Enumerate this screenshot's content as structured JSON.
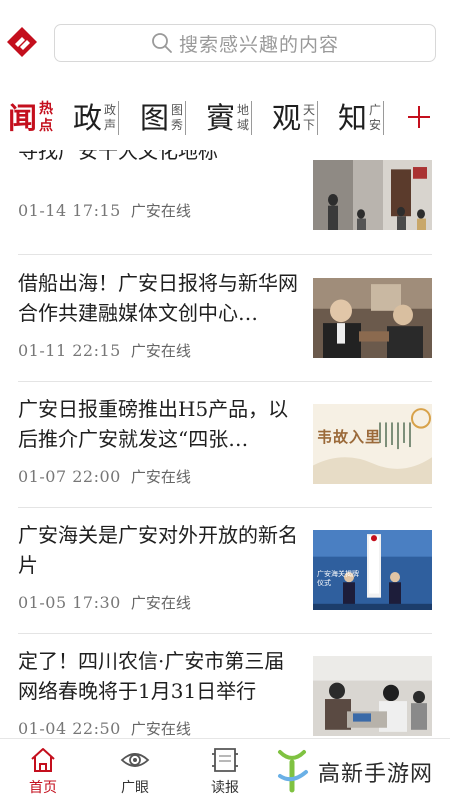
{
  "app": {
    "accent_color": "#c40f1d"
  },
  "search": {
    "placeholder": "搜索感兴趣的内容",
    "icon": "search-icon"
  },
  "tabs": [
    {
      "main": "闻",
      "sub": [
        "热",
        "点"
      ],
      "active": true
    },
    {
      "main": "政",
      "sub": [
        "政",
        "声"
      ],
      "active": false
    },
    {
      "main": "图",
      "sub": [
        "图",
        "秀"
      ],
      "active": false
    },
    {
      "main": "賨",
      "sub": [
        "地",
        "域"
      ],
      "active": false
    },
    {
      "main": "观",
      "sub": [
        "天",
        "下"
      ],
      "active": false
    },
    {
      "main": "知",
      "sub": [
        "广",
        "安"
      ],
      "active": false
    }
  ],
  "tab_more_icon": "plus-icon",
  "news": [
    {
      "title": "寻找广安十大文化地标",
      "time": "01-14  17:15",
      "source": "广安在线",
      "thumb": "street-photo"
    },
    {
      "title": "借船出海！广安日报将与新华网合作共建融媒体文创中心…",
      "time": "01-11  22:15",
      "source": "广安在线",
      "thumb": "meeting-photo"
    },
    {
      "title": "广安日报重磅推出H5产品，以后推介广安就发这“四张…",
      "time": "01-07  22:00",
      "source": "广安在线",
      "thumb": "h5-poster",
      "thumb_text": "韦故入里"
    },
    {
      "title": "广安海关是广安对外开放的新名片",
      "time": "01-05  17:30",
      "source": "广安在线",
      "thumb": "ceremony-photo",
      "thumb_text": "广安海关揭牌仪式"
    },
    {
      "title": "定了！四川农信·广安市第三届网络春晚将于1月31日举行",
      "time": "01-04  22:50",
      "source": "广安在线",
      "thumb": "office-photo"
    }
  ],
  "bottom_nav": [
    {
      "label": "首页",
      "icon": "home-icon",
      "active": true
    },
    {
      "label": "广眼",
      "icon": "eye-icon",
      "active": false
    },
    {
      "label": "读报",
      "icon": "newspaper-icon",
      "active": false
    }
  ],
  "watermark": {
    "text": "高新手游网"
  }
}
